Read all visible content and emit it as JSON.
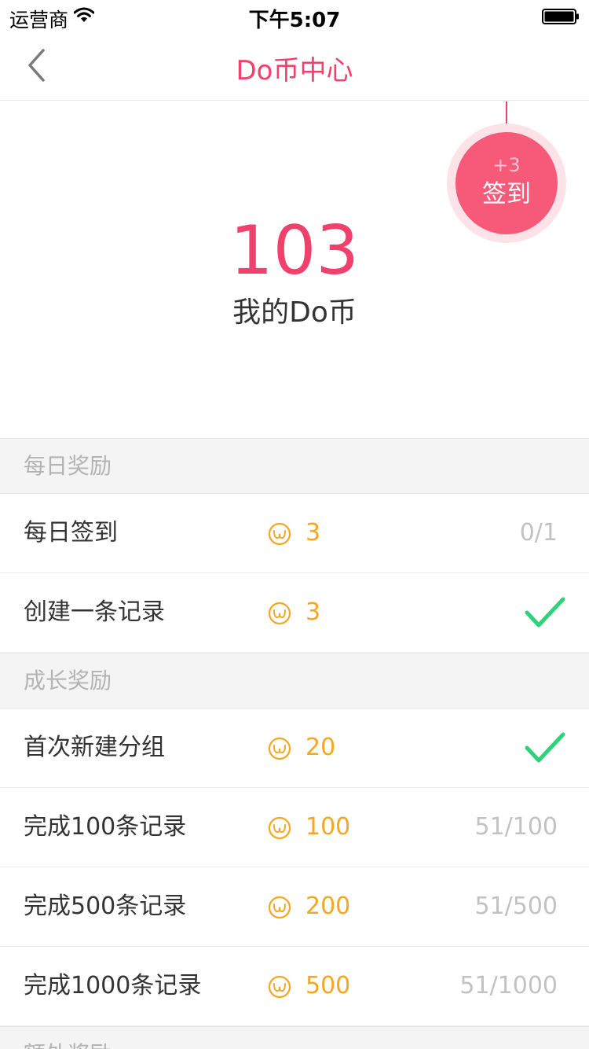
{
  "status_bar": {
    "carrier": "运营商",
    "time": "下午5:07"
  },
  "nav": {
    "title": "Do币中心"
  },
  "hero": {
    "signin_bonus": "+3",
    "signin_label": "签到",
    "coin_count": "103",
    "coin_label": "我的Do币"
  },
  "sections": {
    "daily": {
      "title": "每日奖励",
      "rows": [
        {
          "title": "每日签到",
          "reward": "3",
          "progress": "0/1",
          "completed": false
        },
        {
          "title": "创建一条记录",
          "reward": "3",
          "progress": "",
          "completed": true
        }
      ]
    },
    "growth": {
      "title": "成长奖励",
      "rows": [
        {
          "title": "首次新建分组",
          "reward": "20",
          "progress": "",
          "completed": true
        },
        {
          "title": "完成100条记录",
          "reward": "100",
          "progress": "51/100",
          "completed": false
        },
        {
          "title": "完成500条记录",
          "reward": "200",
          "progress": "51/500",
          "completed": false
        },
        {
          "title": "完成1000条记录",
          "reward": "500",
          "progress": "51/1000",
          "completed": false
        }
      ]
    },
    "extra": {
      "title": "额外奖励"
    }
  },
  "icons": {
    "coin": "do-coin-icon",
    "check": "check-icon",
    "back": "back-chevron-icon",
    "wifi": "wifi-icon",
    "battery": "battery-icon"
  },
  "colors": {
    "accent": "#f0416c",
    "signin_button": "#f65a78",
    "reward": "#f5a623",
    "check": "#2fd27a",
    "muted": "#c2c2c2"
  }
}
